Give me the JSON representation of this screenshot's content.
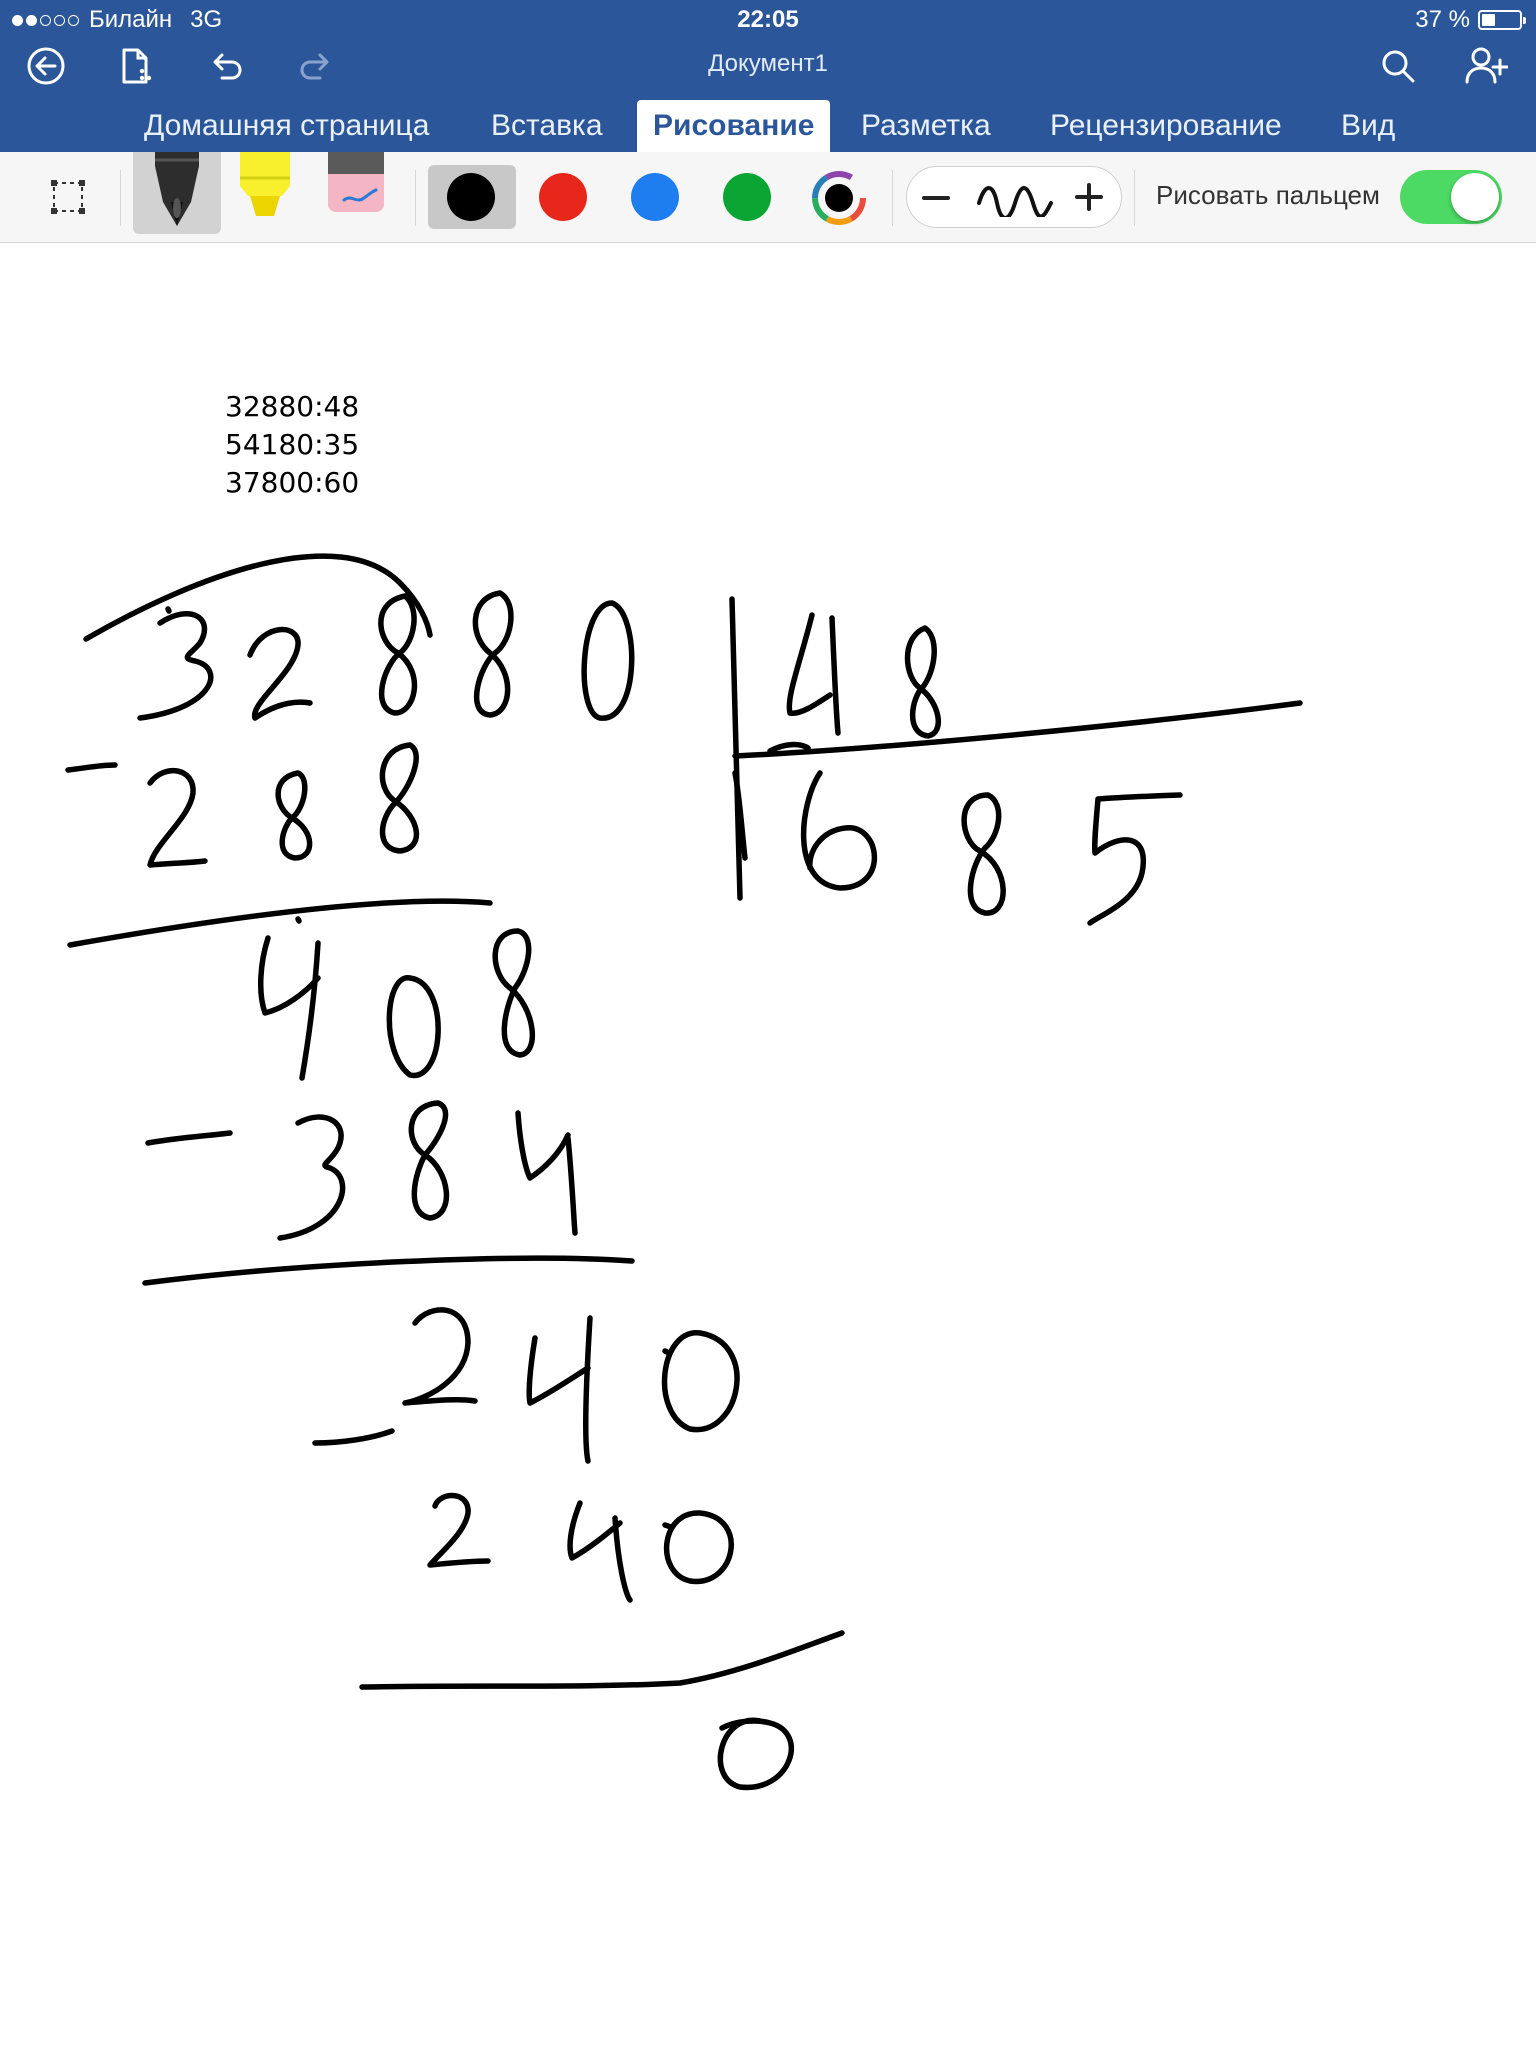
{
  "status_bar": {
    "carrier": "Билайн",
    "network": "3G",
    "time": "22:05",
    "battery": "37 %",
    "battery_fraction": 0.37,
    "signal_bars_filled": 2,
    "signal_bars_total": 5
  },
  "nav": {
    "back_icon": "back-circle-icon",
    "file_icon": "file-icon",
    "undo_icon": "undo-icon",
    "redo_icon": "redo-icon",
    "search_icon": "search-icon",
    "share_icon": "add-person-icon",
    "document_title": "Документ1"
  },
  "tabs": [
    {
      "label": "Домашняя страница",
      "active": false
    },
    {
      "label": "Вставка",
      "active": false
    },
    {
      "label": "Рисование",
      "active": true
    },
    {
      "label": "Разметка",
      "active": false
    },
    {
      "label": "Рецензирование",
      "active": false
    },
    {
      "label": "Вид",
      "active": false
    }
  ],
  "toolbar": {
    "tools": [
      "select-lasso-icon",
      "pen-icon",
      "highlighter-icon",
      "eraser-icon"
    ],
    "selected_tool": "pen-icon",
    "colors": [
      {
        "name": "black",
        "hex": "#000000",
        "selected": true
      },
      {
        "name": "red",
        "hex": "#e8271c"
      },
      {
        "name": "blue",
        "hex": "#1e7ef0"
      },
      {
        "name": "green",
        "hex": "#0ba534"
      },
      {
        "name": "more-colors",
        "hex": "#000000"
      }
    ],
    "thickness_icons": [
      "minus-icon",
      "stroke-wave-icon",
      "plus-icon"
    ],
    "draw_with_finger_label": "Рисовать пальцем",
    "draw_with_finger_on": true
  },
  "document": {
    "typed_lines": [
      "32880:48",
      "54180:35",
      "37800:60"
    ],
    "ink_numbers": {
      "dividend": "32880",
      "divisor": "48",
      "quotient": "685",
      "step1": "288",
      "step2": "408",
      "step3": "384",
      "step4": "240",
      "step5": "240",
      "remainder": "0"
    }
  },
  "colors": {
    "ribbon": "#2b579a",
    "toggle_on": "#4cd964"
  }
}
